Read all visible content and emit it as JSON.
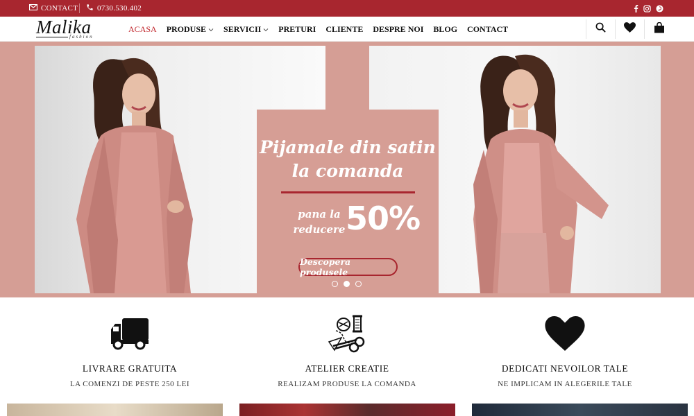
{
  "colors": {
    "brand_red": "#a8262f",
    "nav_active": "#c1272d",
    "hero_bg": "#d59e95"
  },
  "topbar": {
    "contact_label": "CONTACT",
    "phone": "0730.530.402",
    "social_icons": [
      "facebook-icon",
      "instagram-icon",
      "pinterest-icon"
    ]
  },
  "header": {
    "logo_main": "Malika",
    "logo_sub": "fashion",
    "nav": [
      {
        "label": "ACASA",
        "active": true,
        "has_dropdown": false
      },
      {
        "label": "PRODUSE",
        "active": false,
        "has_dropdown": true
      },
      {
        "label": "SERVICII",
        "active": false,
        "has_dropdown": true
      },
      {
        "label": "PRETURI",
        "active": false,
        "has_dropdown": false
      },
      {
        "label": "CLIENTE",
        "active": false,
        "has_dropdown": false
      },
      {
        "label": "DESPRE NOI",
        "active": false,
        "has_dropdown": false
      },
      {
        "label": "BLOG",
        "active": false,
        "has_dropdown": false
      },
      {
        "label": "CONTACT",
        "active": false,
        "has_dropdown": false
      }
    ],
    "icons": [
      "search-icon",
      "heart-icon",
      "bag-icon"
    ]
  },
  "hero": {
    "title_line1": "Pijamale din satin",
    "title_line2": "la comanda",
    "sub_line1": "pana la",
    "sub_line2": "reducere",
    "percent": "50%",
    "button": "Descopera produsele",
    "slides": 3,
    "active_slide": 2
  },
  "features": [
    {
      "icon": "truck-icon",
      "title": "LIVRARE GRATUITA",
      "subtitle": "LA COMENZI DE PESTE 250 LEI"
    },
    {
      "icon": "sewing-tools-icon",
      "title": "ATELIER CREATIE",
      "subtitle": "REALIZAM PRODUSE LA COMANDA"
    },
    {
      "icon": "heart-icon",
      "title": "DEDICATI NEVOILOR TALE",
      "subtitle": "NE IMPLICAM IN ALEGERILE TALE"
    }
  ]
}
